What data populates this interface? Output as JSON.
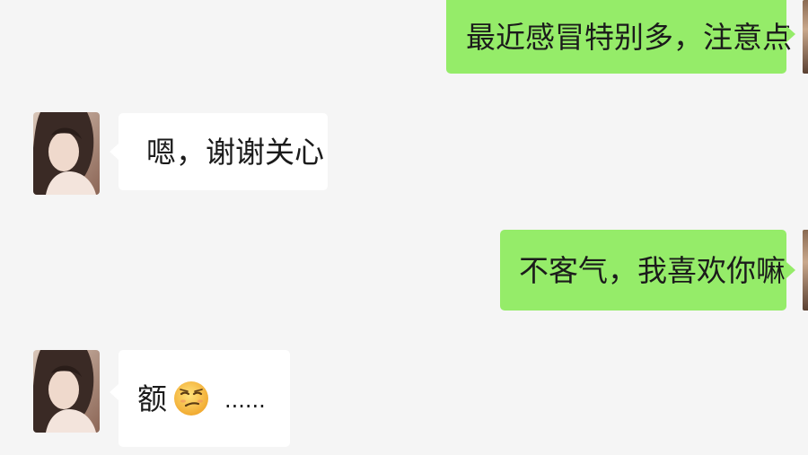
{
  "chat": {
    "messages": [
      {
        "direction": "outgoing",
        "text": "最近感冒特别多，注意点"
      },
      {
        "direction": "incoming",
        "text": "嗯，谢谢关心",
        "avatar": "contact-avatar"
      },
      {
        "direction": "outgoing",
        "text": "不客气，我喜欢你嘛"
      },
      {
        "direction": "incoming",
        "text_before": "额",
        "emoji": "smirk-face-emoji",
        "text_after": "......",
        "avatar": "contact-avatar"
      }
    ]
  },
  "colors": {
    "background": "#f5f5f5",
    "outgoing_bubble": "#95ec69",
    "incoming_bubble": "#ffffff",
    "text": "#1b1b1b"
  }
}
